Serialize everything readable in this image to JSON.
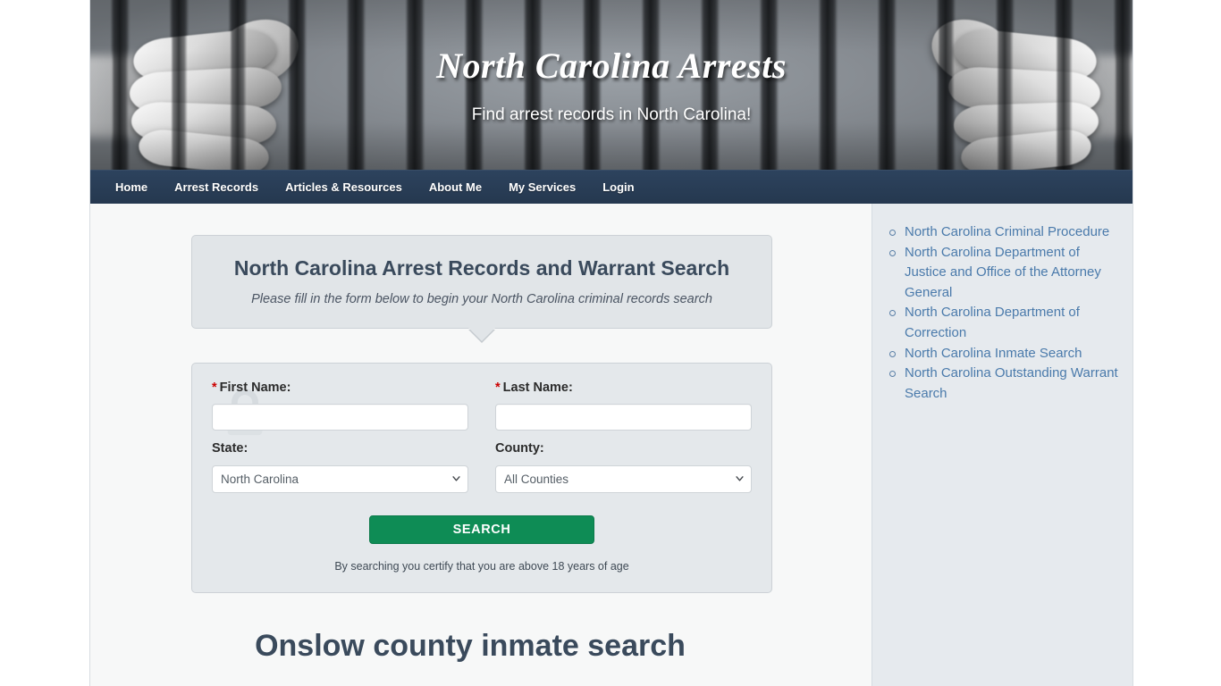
{
  "site": {
    "title": "North Carolina Arrests",
    "tagline": "Find arrest records in North Carolina!"
  },
  "nav": {
    "items": [
      {
        "label": "Home"
      },
      {
        "label": "Arrest Records"
      },
      {
        "label": "Articles & Resources"
      },
      {
        "label": "About Me"
      },
      {
        "label": "My Services"
      },
      {
        "label": "Login"
      }
    ]
  },
  "search_widget": {
    "heading": "North Carolina Arrest Records and Warrant Search",
    "subheading": "Please fill in the form below to begin your North Carolina criminal records search",
    "first_name_label": "First Name:",
    "last_name_label": "Last Name:",
    "state_label": "State:",
    "county_label": "County:",
    "required_marker": "*",
    "first_name_value": "",
    "last_name_value": "",
    "state_value": "North Carolina",
    "county_value": "All Counties",
    "state_options": [
      "North Carolina"
    ],
    "county_options": [
      "All Counties"
    ],
    "search_button_label": "SEARCH",
    "disclaimer": "By searching you certify that you are above 18 years of age",
    "watermark_icon": "padlock-icon"
  },
  "article": {
    "title": "Onslow county inmate search"
  },
  "sidebar": {
    "links": [
      {
        "label": "North Carolina Criminal Procedure"
      },
      {
        "label": "North Carolina Department of Justice and Office of the Attorney General"
      },
      {
        "label": "North Carolina Department of Correction"
      },
      {
        "label": "North Carolina Inmate Search"
      },
      {
        "label": "North Carolina Outstanding Warrant Search"
      }
    ]
  },
  "colors": {
    "nav_bg": "#273d56",
    "heading_text": "#3a4a5c",
    "link_blue": "#4a7aab",
    "button_green": "#0e8c55",
    "required_red": "#cc0000",
    "panel_bg": "#e4e8eb",
    "sidebar_bg": "#e6eaee",
    "page_bg": "#f7f8f8"
  }
}
